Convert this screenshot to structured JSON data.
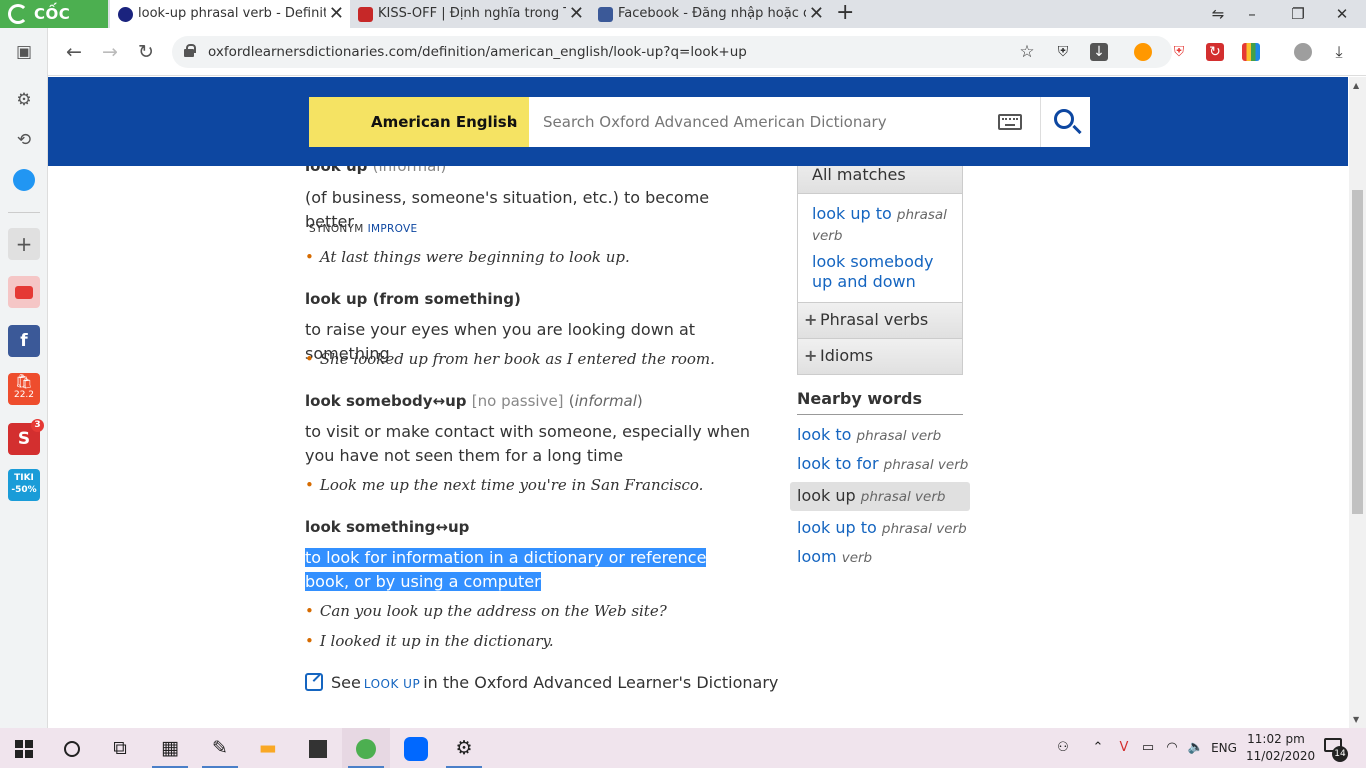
{
  "browser": {
    "brand": "CỐC CỐC",
    "tabs": [
      {
        "title": "look-up phrasal verb - Definit",
        "active": true
      },
      {
        "title": "KISS-OFF | Định nghĩa trong T",
        "active": false
      },
      {
        "title": "Facebook - Đăng nhập hoặc đ",
        "active": false
      }
    ],
    "new_tab": "+",
    "url": "oxfordlearnersdictionaries.com/definition/american_english/look-up?q=look+up",
    "window_controls": [
      "⇋",
      "–",
      "❐",
      "✕"
    ]
  },
  "sidebar": {
    "items": [
      "settings-icon",
      "history-icon",
      "messenger-icon",
      "add-icon",
      "youtube-icon",
      "facebook-icon",
      "shopee-icon",
      "sendo-icon",
      "tiki-icon"
    ],
    "shopee_label": "22.2",
    "sendo_badge": "3",
    "tiki_label": "TIKI -50%"
  },
  "header": {
    "dictionary": "American English",
    "search_placeholder": "Search Oxford Advanced American Dictionary"
  },
  "entry": {
    "sense1": {
      "headword": "look up",
      "label": "(informal)",
      "definition": "(of business, someone's situation, etc.) to become better",
      "synonym_label": "SYNONYM",
      "synonym": "IMPROVE",
      "examples": [
        "At last things were beginning to look up."
      ]
    },
    "sense2": {
      "headword": "look up (from something)",
      "definition": "to raise your eyes when you are looking down at something",
      "examples": [
        "She looked up from her book as I entered the room."
      ]
    },
    "sense3": {
      "headword": "look somebody↔up",
      "grammar": "[no passive]",
      "label_open": "(",
      "label": "informal",
      "label_close": ")",
      "definition": "to visit or make contact with someone, especially when you have not seen them for a long time",
      "examples": [
        "Look me up the next time you're in San Francisco."
      ]
    },
    "sense4": {
      "headword": "look something↔up",
      "definition": "to look for information in a dictionary or reference book, or by using a computer",
      "examples": [
        "Can you look up the address on the Web site?",
        "I looked it up in the dictionary."
      ]
    },
    "see_also": {
      "prefix": "See",
      "word": "LOOK UP",
      "suffix": "in the Oxford Advanced Learner's Dictionary"
    },
    "bullet": "•"
  },
  "matches": {
    "title": "All matches",
    "links": [
      {
        "word": "look up to",
        "pos": "phrasal verb"
      },
      {
        "word": "look somebody up and down",
        "pos": ""
      }
    ],
    "sections": [
      "Phrasal verbs",
      "Idioms"
    ]
  },
  "nearby": {
    "title": "Nearby words",
    "items": [
      {
        "word": "look to",
        "pos": "phrasal verb"
      },
      {
        "word": "look to for",
        "pos": "phrasal verb"
      },
      {
        "word": "look up",
        "pos": "phrasal verb"
      },
      {
        "word": "look up to",
        "pos": "phrasal verb"
      },
      {
        "word": "loom",
        "pos": "verb"
      }
    ]
  },
  "taskbar": {
    "language": "ENG",
    "time": "11:02 pm",
    "date": "11/02/2020",
    "notifications": "14"
  },
  "colors": {
    "header": "#0d47a1",
    "dict_selector": "#f5e363",
    "link": "#1565c0",
    "selection": "#3390ff",
    "bullet": "#d66b00"
  }
}
